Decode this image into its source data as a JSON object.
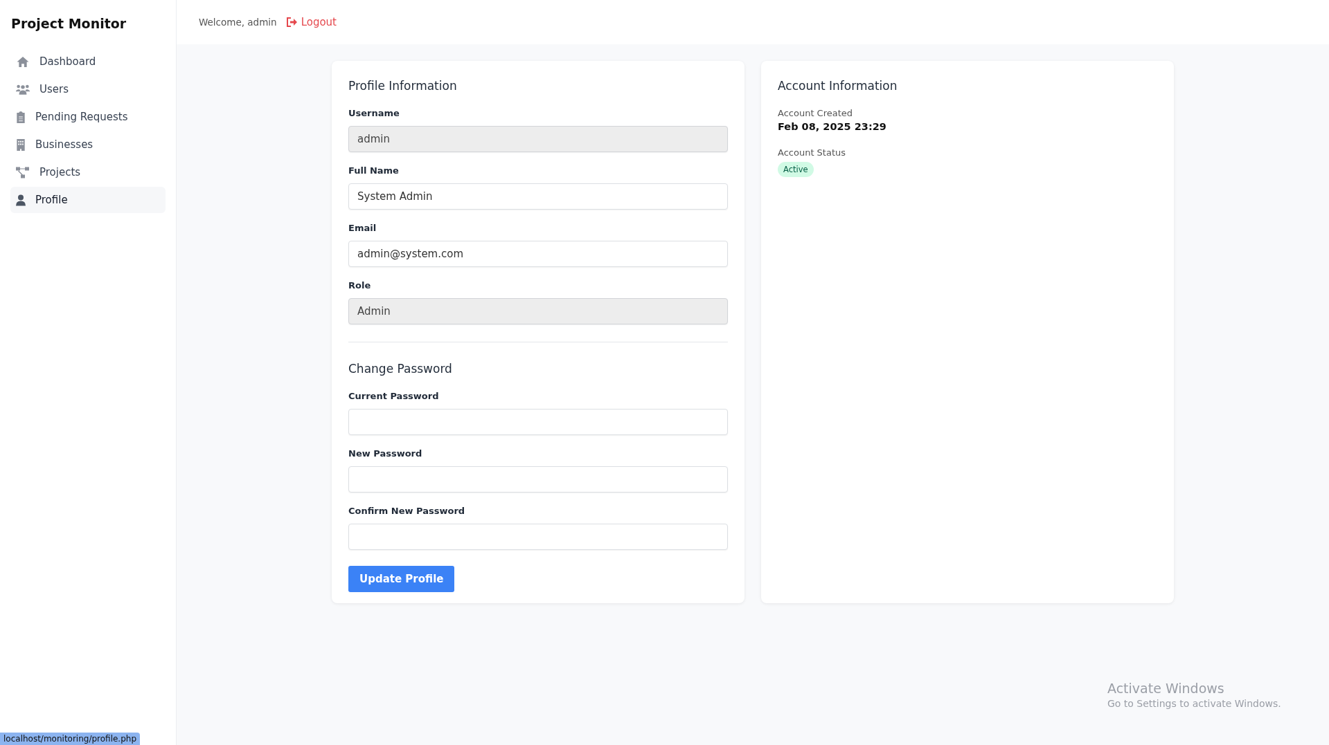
{
  "sidebar": {
    "title": "Project Monitor",
    "items": [
      {
        "label": "Dashboard",
        "selected": false
      },
      {
        "label": "Users",
        "selected": false
      },
      {
        "label": "Pending Requests",
        "selected": false
      },
      {
        "label": "Businesses",
        "selected": false
      },
      {
        "label": "Projects",
        "selected": false
      },
      {
        "label": "Profile",
        "selected": true
      }
    ]
  },
  "header": {
    "welcome": "Welcome, admin",
    "logout": "Logout"
  },
  "profile_card": {
    "title": "Profile Information",
    "fields": [
      {
        "label": "Username",
        "value": "admin",
        "readonly": true
      },
      {
        "label": "Full Name",
        "value": "System Admin",
        "readonly": false
      },
      {
        "label": "Email",
        "value": "admin@system.com",
        "readonly": false
      },
      {
        "label": "Role",
        "value": "Admin",
        "readonly": true
      }
    ],
    "password_title": "Change Password",
    "password_fields": [
      {
        "label": "Current Password"
      },
      {
        "label": "New Password"
      },
      {
        "label": "Confirm New Password"
      }
    ],
    "submit": "Update Profile"
  },
  "account_card": {
    "title": "Account Information",
    "created_label": "Account Created",
    "created_value": "Feb 08, 2025 23:29",
    "status_label": "Account Status",
    "status": "Active"
  },
  "status_url": "localhost/monitoring/profile.php",
  "os_notice": {
    "title": "Activate Windows",
    "text": "Go to Settings to activate Windows."
  }
}
